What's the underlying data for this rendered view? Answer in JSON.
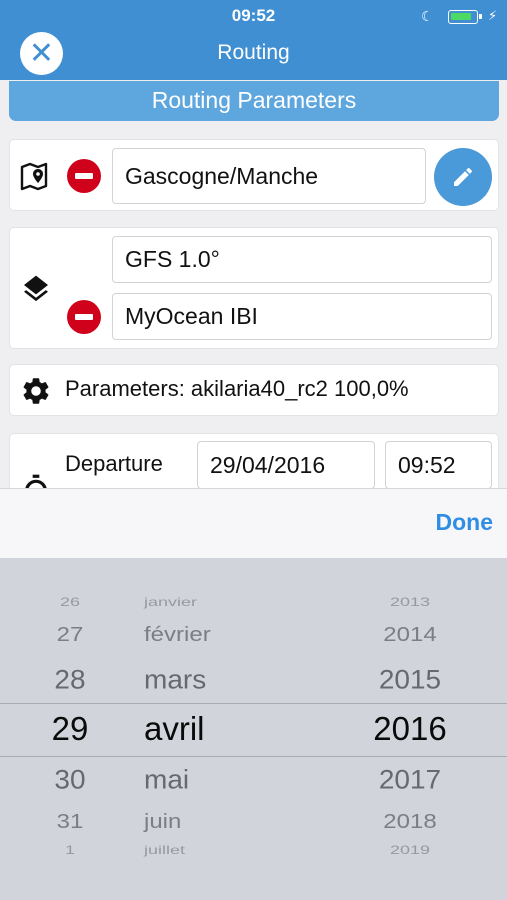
{
  "status_bar": {
    "time": "09:52"
  },
  "nav": {
    "title": "Routing",
    "close_symbol": "✕"
  },
  "section": {
    "header": "Routing Parameters"
  },
  "zone": {
    "value": "Gascogne/Manche"
  },
  "models": {
    "items": [
      "GFS 1.0°",
      "MyOcean IBI"
    ]
  },
  "parameters": {
    "label": "Parameters: akilaria40_rc2 100,0%"
  },
  "departure": {
    "label": "Departure",
    "date": "29/04/2016",
    "time": "09:52"
  },
  "picker_toolbar": {
    "done_label": "Done"
  },
  "date_picker": {
    "days": [
      "26",
      "27",
      "28",
      "29",
      "30",
      "31",
      "1"
    ],
    "months": [
      "janvier",
      "février",
      "mars",
      "avril",
      "mai",
      "juin",
      "juillet"
    ],
    "years": [
      "2013",
      "2014",
      "2015",
      "2016",
      "2017",
      "2018",
      "2019"
    ],
    "selected": {
      "day": "29",
      "month": "avril",
      "year": "2016"
    }
  },
  "colors": {
    "nav_bar": "#3f8fd2",
    "accent": "#2f8de4",
    "delete": "#d0021b",
    "picker_bg": "#d1d5db"
  }
}
